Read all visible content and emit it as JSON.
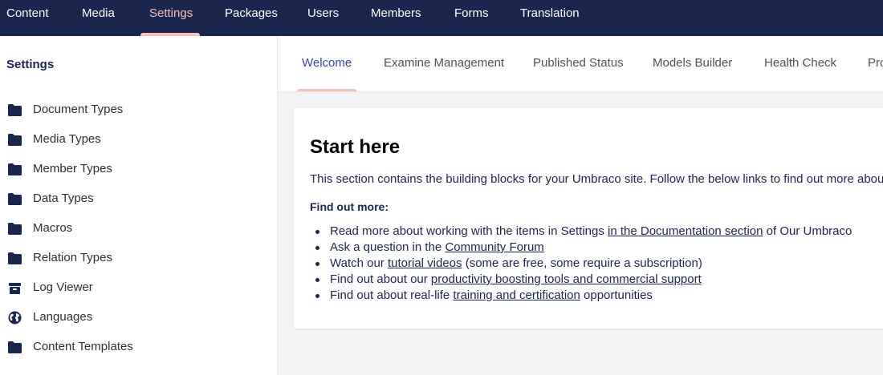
{
  "topnav": {
    "items": [
      {
        "label": "Content"
      },
      {
        "label": "Media"
      },
      {
        "label": "Settings",
        "active": true
      },
      {
        "label": "Packages"
      },
      {
        "label": "Users"
      },
      {
        "label": "Members"
      },
      {
        "label": "Forms"
      },
      {
        "label": "Translation"
      }
    ]
  },
  "sidebar": {
    "title": "Settings",
    "items": [
      {
        "label": "Document Types",
        "icon": "folder-icon"
      },
      {
        "label": "Media Types",
        "icon": "folder-icon"
      },
      {
        "label": "Member Types",
        "icon": "folder-icon"
      },
      {
        "label": "Data Types",
        "icon": "folder-icon"
      },
      {
        "label": "Macros",
        "icon": "folder-icon"
      },
      {
        "label": "Relation Types",
        "icon": "folder-icon"
      },
      {
        "label": "Log Viewer",
        "icon": "archive-box-icon"
      },
      {
        "label": "Languages",
        "icon": "globe-icon"
      },
      {
        "label": "Content Templates",
        "icon": "folder-icon"
      }
    ]
  },
  "tabs": [
    {
      "label": "Welcome",
      "active": true
    },
    {
      "label": "Examine Management"
    },
    {
      "label": "Published Status"
    },
    {
      "label": "Models Builder"
    },
    {
      "label": "Health Check"
    },
    {
      "label": "Pro"
    }
  ],
  "welcome": {
    "title": "Start here",
    "intro": "This section contains the building blocks for your Umbraco site. Follow the below links to find out more about",
    "subheading": "Find out more:",
    "bullets": [
      {
        "before": "Read more about working with the items in Settings ",
        "link": "in the Documentation section",
        "after": " of Our Umbraco"
      },
      {
        "before": "Ask a question in the ",
        "link": "Community Forum",
        "after": ""
      },
      {
        "before": "Watch our ",
        "link": "tutorial videos",
        "after": " (some are free, some require a subscription)"
      },
      {
        "before": "Find out about our ",
        "link": "productivity boosting tools and commercial support",
        "after": ""
      },
      {
        "before": "Find out about real-life ",
        "link": "training and certification",
        "after": " opportunities"
      }
    ]
  },
  "colors": {
    "header_bg": "#1b264f",
    "active_accent": "#f5c1bc",
    "active_tab_text": "#3544b1"
  }
}
